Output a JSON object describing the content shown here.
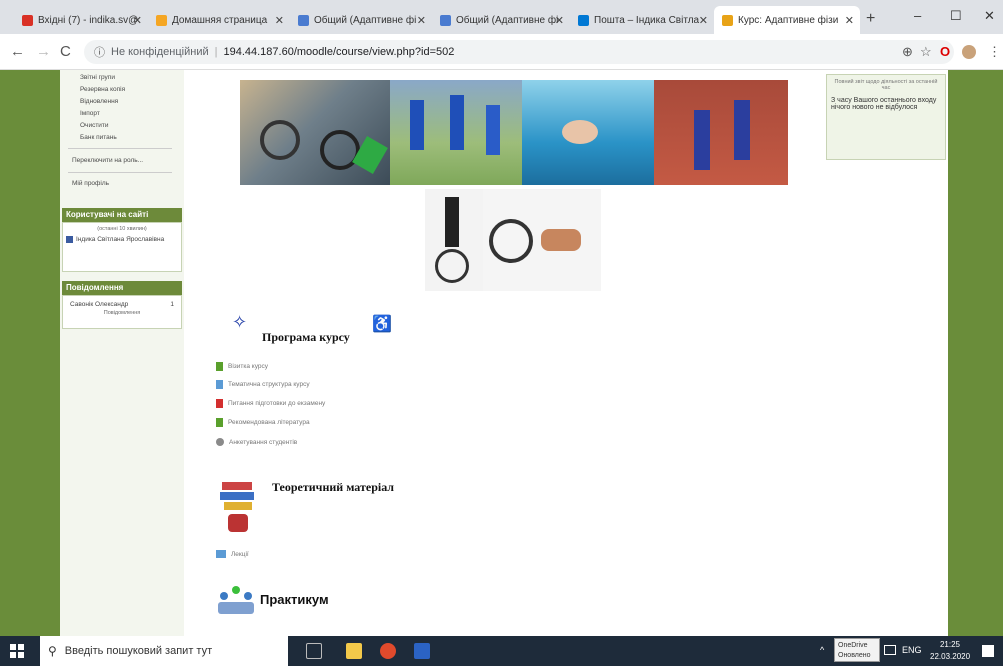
{
  "browser": {
    "tabs": [
      {
        "label": "Вхідні (7) - indika.sv@",
        "color": "#d93025"
      },
      {
        "label": "Домашняя страница",
        "color": "#f5a623"
      },
      {
        "label": "Общий (Адаптивне фі",
        "color": "#4a7bd0"
      },
      {
        "label": "Общий (Адаптивне фі",
        "color": "#4a7bd0"
      },
      {
        "label": "Пошта – Індика Світла",
        "color": "#0078d4"
      },
      {
        "label": "Курс: Адаптивне фізи",
        "color": "#e8a317"
      }
    ],
    "new_tab": "+",
    "minimize": "–",
    "maximize": "☐",
    "close": "✕",
    "back": "←",
    "forward": "→",
    "reload": "C",
    "security": "Не конфіденційний",
    "url": "194.44.187.60/moodle/course/view.php?id=502"
  },
  "left_nav": {
    "items": [
      "Звітні групи",
      "Резервна копія",
      "Відновлення",
      "Імпорт",
      "Очистити",
      "Банк питань",
      "Переключити на роль...",
      "Мій профіль"
    ],
    "users_block": {
      "title": "Користувачі на сайті",
      "subtitle": "(останні 10 хвилин)",
      "user": "Індика Світлана Ярославівна"
    },
    "messages_block": {
      "title": "Повідомлення",
      "sender": "Савонік Олександр",
      "count": "1",
      "link": "Повідомлення"
    }
  },
  "right_block": {
    "line1": "Повний звіт щодо діяльності за останній час",
    "line2": "З часу Вашого останнього входу нічого нового не відбулося"
  },
  "course": {
    "section1_title": "Програма курсу",
    "resources": [
      {
        "label": "Візитка курсу",
        "color": "#5aa02c"
      },
      {
        "label": "Тематична структура курсу",
        "color": "#5b9bd5"
      },
      {
        "label": "Питання підготовки до екзамену",
        "color": "#d32f2f"
      },
      {
        "label": "Рекомендована література",
        "color": "#5aa02c"
      },
      {
        "label": "Анкетування студентів",
        "color": "#8a8a8a"
      }
    ],
    "section2_title": "Теоретичний матеріал",
    "lectures": "Лекції",
    "section3_title": "Практикум"
  },
  "taskbar": {
    "search_placeholder": "Введіть пошуковий запит тут",
    "onedrive_line1": "OneDrive",
    "onedrive_line2": "Оновлено",
    "lang": "ENG",
    "time": "21:25",
    "date": "22.03.2020"
  }
}
